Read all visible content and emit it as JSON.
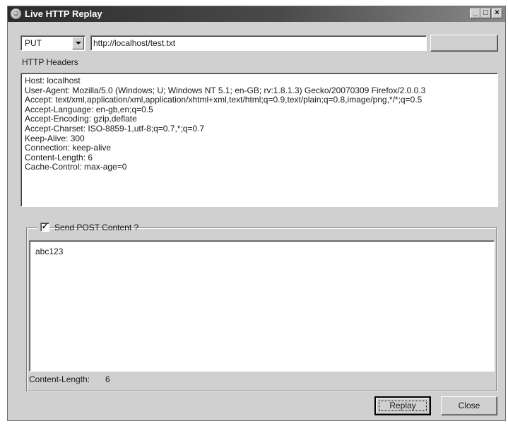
{
  "window": {
    "title": "Live HTTP Replay"
  },
  "controls": {
    "minimize": "_",
    "maximize": "□",
    "close": "×"
  },
  "request": {
    "method": "PUT",
    "url": "http://localhost/test.txt"
  },
  "headers": {
    "label": "HTTP Headers",
    "lines": [
      "Host: localhost",
      "User-Agent: Mozilla/5.0 (Windows; U; Windows NT 5.1; en-GB; rv:1.8.1.3) Gecko/20070309 Firefox/2.0.0.3",
      "Accept: text/xml,application/xml,application/xhtml+xml,text/html;q=0.9,text/plain;q=0.8,image/png,*/*;q=0.5",
      "Accept-Language: en-gb,en;q=0.5",
      "Accept-Encoding: gzip,deflate",
      "Accept-Charset: ISO-8859-1,utf-8;q=0.7,*;q=0.7",
      "Keep-Alive: 300",
      "Connection: keep-alive",
      "Content-Length: 6",
      "Cache-Control: max-age=0"
    ]
  },
  "post": {
    "checkbox_label": "Send POST Content ?",
    "checked": true,
    "check_mark": "✓",
    "content": "abc123",
    "content_length_label": "Content-Length:",
    "content_length_value": "6"
  },
  "buttons": {
    "replay": "Replay",
    "close": "Close"
  }
}
